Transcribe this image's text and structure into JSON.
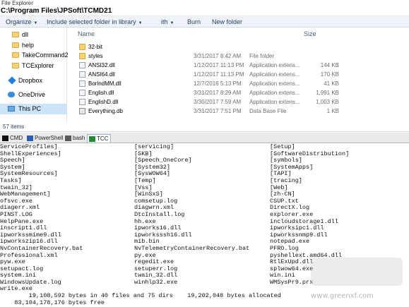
{
  "window": {
    "title": "File Explorer"
  },
  "address": {
    "path": "C:\\Program Files\\JPSoft\\TCMD21"
  },
  "toolbar": {
    "organize": "Organize",
    "include": "Include selected folder in library",
    "with": "ith",
    "burn": "Burn",
    "new_folder": "New folder"
  },
  "nav": {
    "items": [
      {
        "label": "dll",
        "icon": "folder-icon"
      },
      {
        "label": "help",
        "icon": "folder-icon"
      },
      {
        "label": "TakeCommand2",
        "icon": "folder-icon"
      },
      {
        "label": "TCExplorer",
        "icon": "folder-icon"
      },
      {
        "label": "Dropbox",
        "icon": "dropbox-icon"
      },
      {
        "label": "OneDrive",
        "icon": "onedrive-icon"
      },
      {
        "label": "This PC",
        "icon": "computer-icon"
      }
    ]
  },
  "filelist": {
    "columns": {
      "name": "Name",
      "size": "Size"
    },
    "rows": [
      {
        "name": "32-bit",
        "date": "",
        "type": "",
        "size": "",
        "icon": "folder-icon"
      },
      {
        "name": "styles",
        "date": "3/31/2017 8:42 AM",
        "type": "File folder",
        "size": "",
        "icon": "folder-icon"
      },
      {
        "name": "ANSI32.dll",
        "date": "1/12/2017 11:13 PM",
        "type": "Application extens...",
        "size": "144 KB",
        "icon": "dll-icon"
      },
      {
        "name": "ANSI64.dll",
        "date": "1/12/2017 11:13 PM",
        "type": "Application extens...",
        "size": "170 KB",
        "icon": "dll-icon"
      },
      {
        "name": "BorlndMM.dll",
        "date": "12/7/2016 5:13 PM",
        "type": "Application extens...",
        "size": "41 KB",
        "icon": "dll-icon"
      },
      {
        "name": "English.dll",
        "date": "3/31/2017 8:29 AM",
        "type": "Application extens...",
        "size": "1,991 KB",
        "icon": "dll-icon"
      },
      {
        "name": "EnglishD.dll",
        "date": "3/30/2017 7:59 AM",
        "type": "Application extens...",
        "size": "1,003 KB",
        "icon": "dll-icon"
      },
      {
        "name": "Everything.db",
        "date": "3/31/2017 7:51 PM",
        "type": "Data Base File",
        "size": "1 KB",
        "icon": "db-icon"
      }
    ]
  },
  "status": {
    "items": "57 items"
  },
  "tabs": [
    {
      "label": "CMD",
      "icon": "cmd-icon",
      "active": false
    },
    {
      "label": "PowerShell",
      "icon": "powershell-icon",
      "active": false
    },
    {
      "label": "bash",
      "icon": "bash-icon",
      "active": false
    },
    {
      "label": "TCC",
      "icon": "tcc-icon",
      "active": true
    }
  ],
  "console": {
    "col1": [
      "ServiceProfiles]",
      "ShellExperiences]",
      "Speech]",
      "System]",
      "SystemResources]",
      "Tasks]",
      "twain_32]",
      "WebManagement]",
      "ofsvc.exe",
      "diagerr.xml",
      "PINST.LOG",
      "HelpPane.exe",
      "inscript1.dll",
      "ipworkssmime9.dll",
      "ipworkszip16.dll",
      "NvContainerRecovery.bat",
      "Professional.xml",
      "pyw.exe",
      "setupact.log",
      "system.ini",
      "WindowsUpdate.log",
      "write.exe"
    ],
    "col2": [
      "[servicing]",
      "[SKB]",
      "[Speech_OneCore]",
      "[System32]",
      "[SysWOW64]",
      "[Temp]",
      "[Vss]",
      "[WinSxS]",
      "comsetup.log",
      "diagwrn.xml",
      "DtcInstall.log",
      "hh.exe",
      "ipworks16.dll",
      "ipworksssh16.dll",
      "mib.bin",
      "NvTelemetryContainerRecovery.bat",
      "py.exe",
      "regedit.exe",
      "setuperr.log",
      "twain_32.dll",
      "winhlp32.exe"
    ],
    "col3": [
      "[Setup]",
      "[SoftwareDistribution]",
      "[symbols]",
      "[SystemApps]",
      "[TAPI]",
      "[tracing]",
      "[Web]",
      "[zh-CN]",
      "CSUP.txt",
      "DirectX.log",
      "explorer.exe",
      "incloudstorage1.dll",
      "ipworksipc1.dll",
      "ipworkssnmp9.dll",
      "notepad.exe",
      "PFRO.log",
      "pyshellext.amd64.dll",
      "RtlExUpd.dll",
      "splwow64.exe",
      "win.ini",
      "WMSysPr9.prx"
    ],
    "summary1": "        19,108,592 bytes in 40 files and 75 dirs    19,202,048 bytes allocated",
    "summary2": "    83,104,178,176 bytes free"
  },
  "watermark": {
    "text": "www.greenxf.com"
  }
}
